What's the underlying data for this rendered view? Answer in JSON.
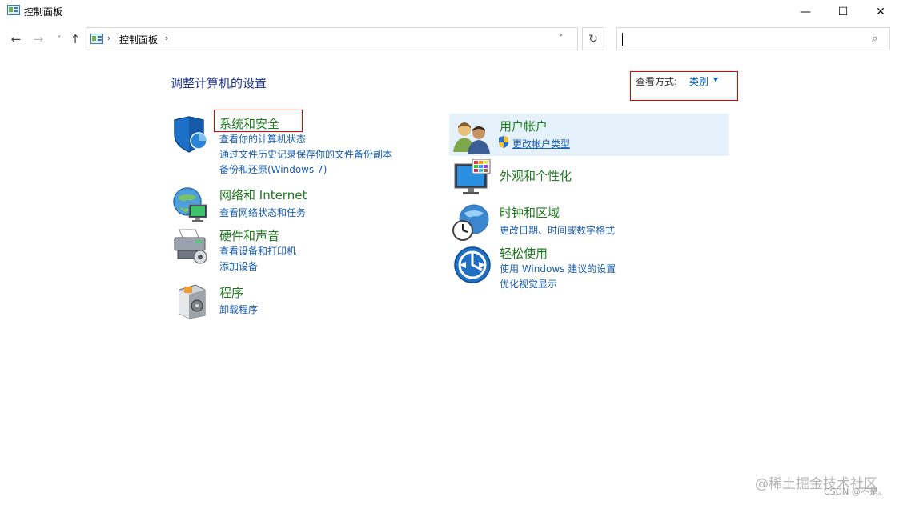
{
  "window": {
    "title": "控制面板",
    "minimize_icon": "minimize-icon",
    "maximize_icon": "maximize-icon",
    "close_icon": "close-icon",
    "minimize_glyph": "—",
    "maximize_glyph": "☐",
    "close_glyph": "✕"
  },
  "nav": {
    "back_glyph": "←",
    "forward_glyph": "→",
    "recent_glyph": "˅",
    "up_glyph": "↑",
    "refresh_glyph": "↻"
  },
  "address": {
    "sep": "›",
    "path": "控制面板",
    "dropdown_glyph": "˅"
  },
  "search": {
    "value": "",
    "icon_glyph": "⌕"
  },
  "main": {
    "heading": "调整计算机的设置",
    "view_by_label": "查看方式:",
    "view_by_value": "类别",
    "view_by_arrow": "▼"
  },
  "categories_left": [
    {
      "title": "系统和安全",
      "links": [
        "查看你的计算机状态",
        "通过文件历史记录保存你的文件备份副本",
        "备份和还原(Windows 7)"
      ]
    },
    {
      "title": "网络和 Internet",
      "links": [
        "查看网络状态和任务"
      ]
    },
    {
      "title": "硬件和声音",
      "links": [
        "查看设备和打印机",
        "添加设备"
      ]
    },
    {
      "title": "程序",
      "links": [
        "卸载程序"
      ]
    }
  ],
  "categories_right": [
    {
      "title": "用户帐户",
      "links": [
        "更改帐户类型"
      ]
    },
    {
      "title": "外观和个性化",
      "links": []
    },
    {
      "title": "时钟和区域",
      "links": [
        "更改日期、时间或数字格式"
      ]
    },
    {
      "title": "轻松使用",
      "links": [
        "使用 Windows 建议的设置",
        "优化视觉显示"
      ]
    }
  ],
  "colors": {
    "category_title": "#1e7a1e",
    "link": "#1a5fb4",
    "heading": "#1e3287",
    "highlight_box": "#e60000",
    "hover_bg": "#e5f1fb"
  },
  "watermark": {
    "line1": "@稀土掘金技术社区",
    "line2": "CSDN @不是。"
  }
}
